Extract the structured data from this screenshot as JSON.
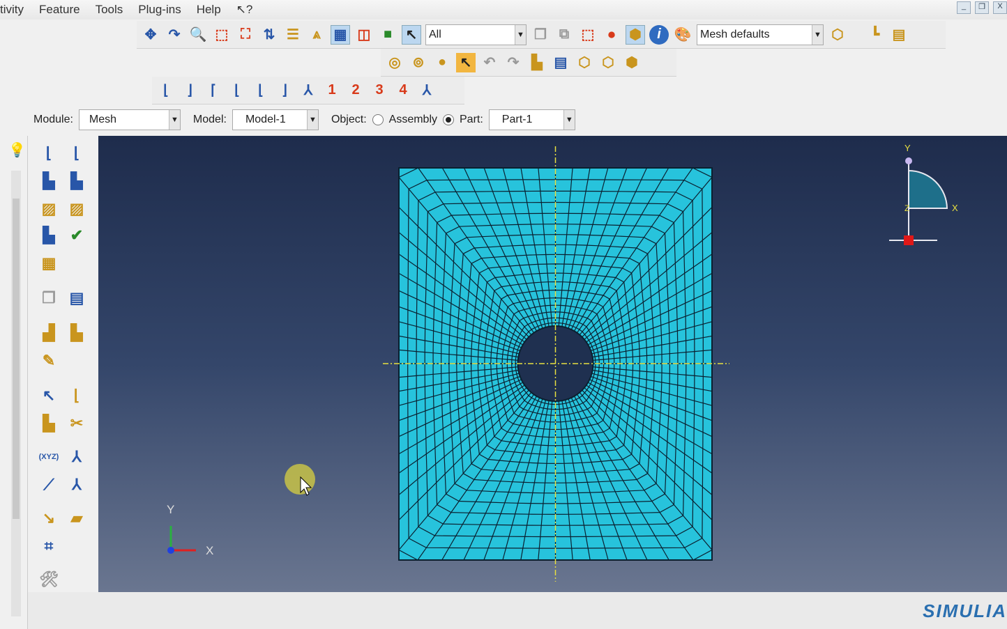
{
  "menu": [
    "tivity",
    "Feature",
    "Tools",
    "Plug-ins",
    "Help",
    "↖?"
  ],
  "window_buttons": [
    "_",
    "❐",
    "X"
  ],
  "toolbar": {
    "selection_filter": "All",
    "render_style": "Mesh defaults",
    "views": [
      "1",
      "2",
      "3",
      "4"
    ]
  },
  "context": {
    "module_label": "Module:",
    "module_value": "Mesh",
    "model_label": "Model:",
    "model_value": "Model-1",
    "object_label": "Object:",
    "assembly_label": "Assembly",
    "part_label": "Part:",
    "object_selected": "Part",
    "part_value": "Part-1"
  },
  "viewport": {
    "triad_x": "X",
    "triad_y": "Y",
    "triad_z": "Z",
    "mesh_color": "#27c3dc",
    "mesh_line_color": "#0b2030",
    "construction_line_color": "#e8e040"
  },
  "brand": "SIMULIA"
}
